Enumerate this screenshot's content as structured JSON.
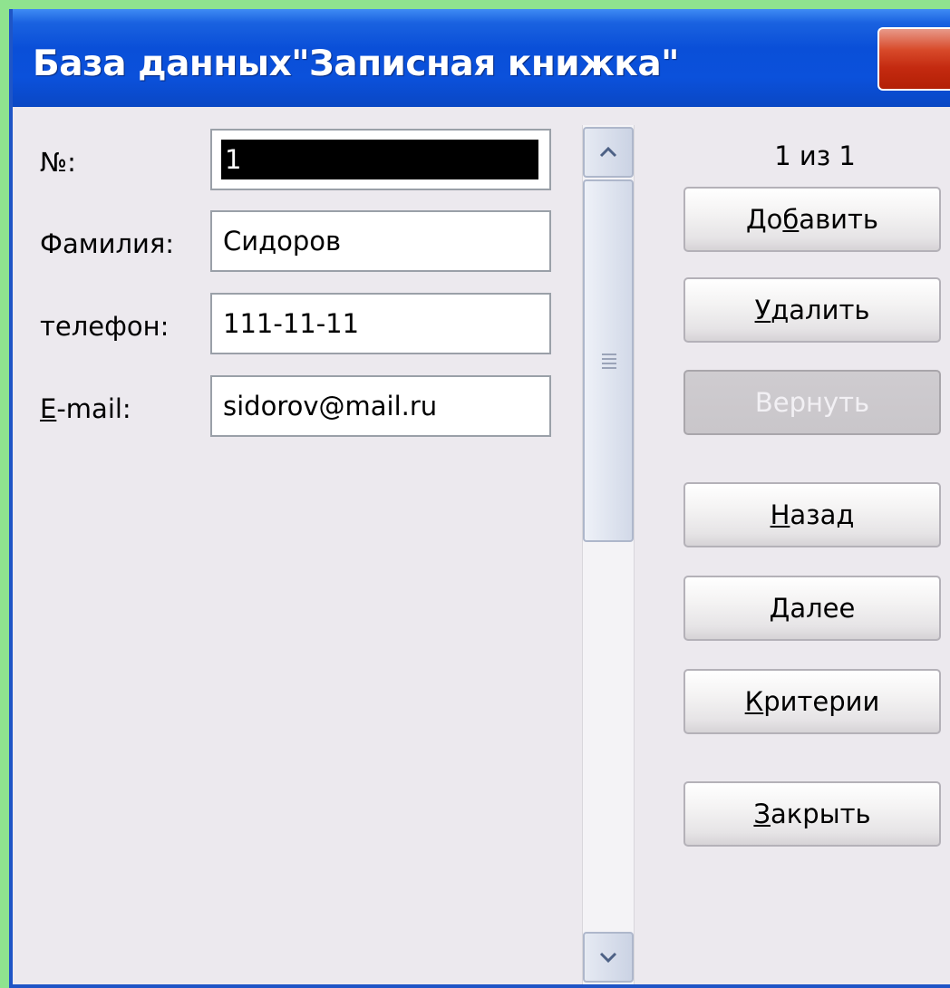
{
  "window": {
    "title": "База данных\"Записная книжка\""
  },
  "fields": [
    {
      "label_prefix": "",
      "label_u": "",
      "label_rest": "№:",
      "value": "1"
    },
    {
      "label_prefix": "",
      "label_u": "",
      "label_rest": "Фамилия:",
      "value": "Сидоров"
    },
    {
      "label_prefix": "",
      "label_u": "",
      "label_rest": "телефон:",
      "value": "111-11-11"
    },
    {
      "label_prefix": "",
      "label_u": "E",
      "label_rest": "-mail:",
      "value": "sidorov@mail.ru"
    }
  ],
  "record_counter": "1 из 1",
  "buttons": {
    "add": {
      "pre": "До",
      "u": "б",
      "post": "авить"
    },
    "delete": {
      "pre": "",
      "u": "У",
      "post": "далить"
    },
    "restore": {
      "pre": "",
      "u": "",
      "post": "Вернуть"
    },
    "back": {
      "pre": "",
      "u": "Н",
      "post": "азад"
    },
    "next": {
      "pre": "",
      "u": "Д",
      "post": "алее"
    },
    "criteria": {
      "pre": "",
      "u": "К",
      "post": "ритерии"
    },
    "close": {
      "pre": "",
      "u": "З",
      "post": "акрыть"
    }
  },
  "icons": {
    "close": "close-icon",
    "scroll_up": "chevron-up-icon",
    "scroll_down": "chevron-down-icon",
    "grip": "grip-icon"
  },
  "colors": {
    "titlebar": "#0a4fd8",
    "close_button": "#c42a10",
    "dialog_bg": "#ece9ee",
    "page_bg": "#8fe38f"
  }
}
